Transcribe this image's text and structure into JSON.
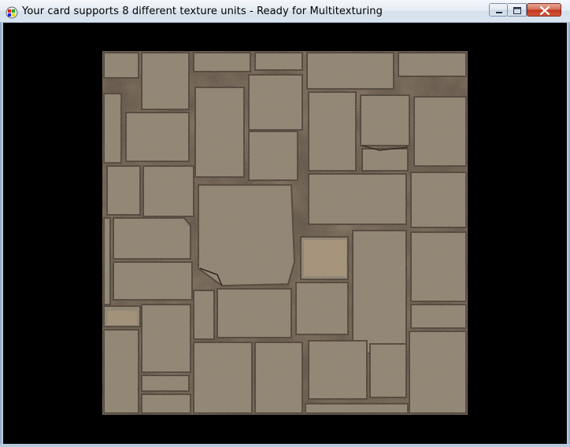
{
  "window": {
    "title": "Your card supports 8 different texture units - Ready for Multitexturing",
    "icon": "opengl-app-icon"
  },
  "controls": {
    "minimize": "minimize-icon",
    "maximize": "maximize-icon",
    "close": "close-icon"
  },
  "colors": {
    "client_background": "#000000",
    "stone_base": "#8b7e6c",
    "mortar": "#4a3f33"
  },
  "scene": {
    "texture": "stone-tile-floor"
  }
}
